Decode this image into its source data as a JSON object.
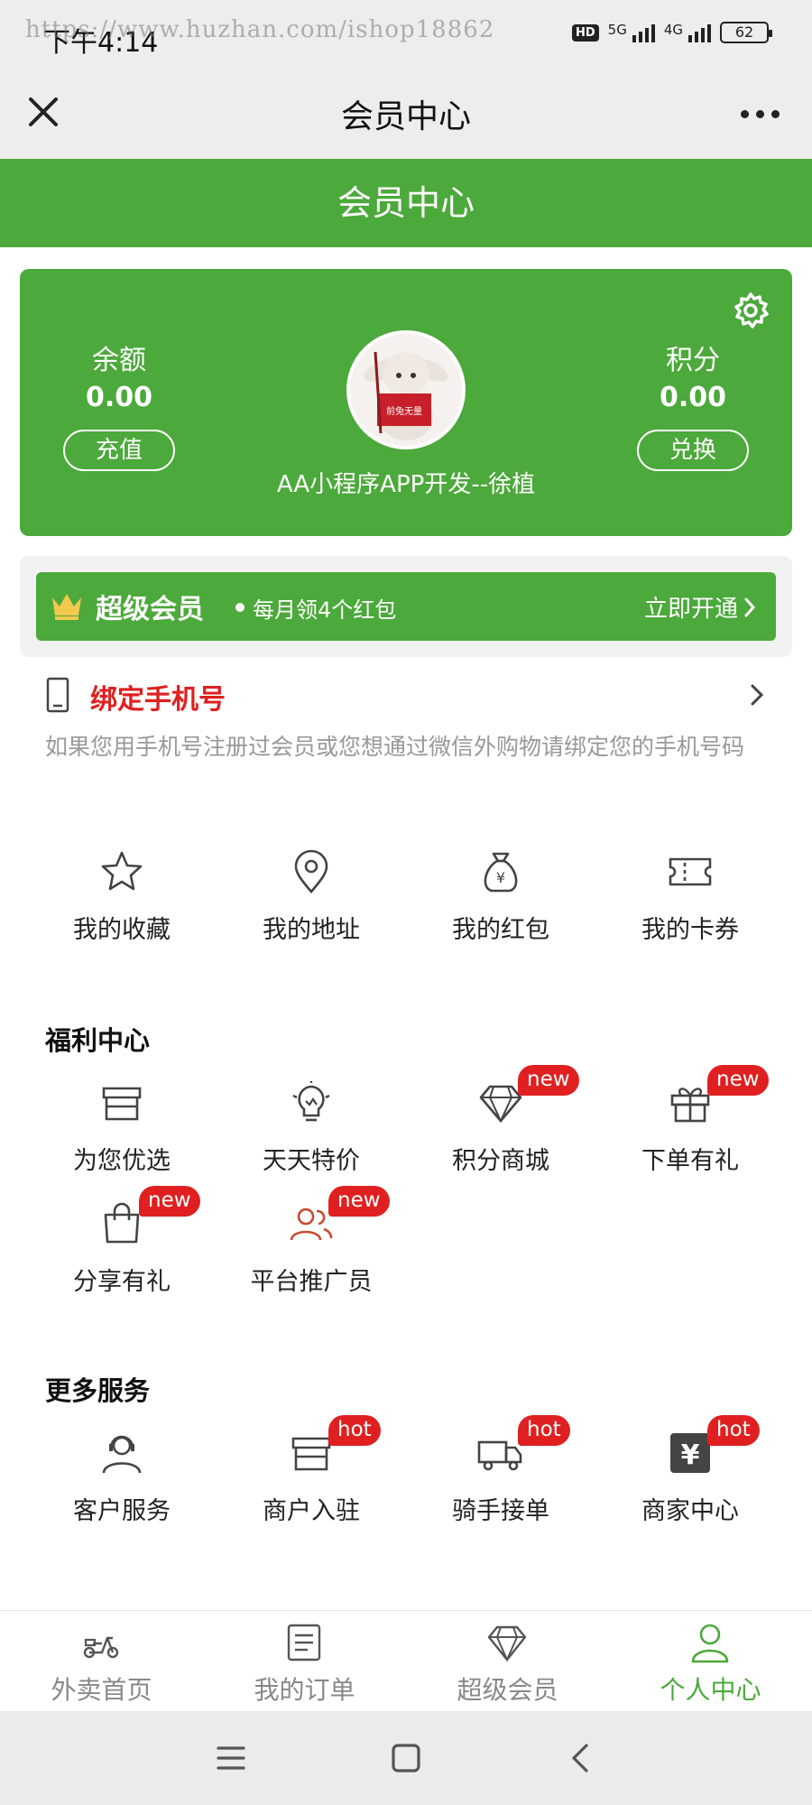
{
  "status_bar": {
    "time": "下午4:14",
    "watermark": "https://www.huzhan.com/ishop18862",
    "hd": "HD",
    "net1": "5G",
    "net2": "4G",
    "battery": "62"
  },
  "title_bar": {
    "title": "会员中心",
    "close_icon": "close-icon",
    "more_icon": "more-icon"
  },
  "header": {
    "title": "会员中心"
  },
  "member_card": {
    "balance_label": "余额",
    "balance_value": "0.00",
    "recharge_label": "充值",
    "points_label": "积分",
    "points_value": "0.00",
    "redeem_label": "兑换",
    "nickname": "AA小程序APP开发--徐植",
    "avatar_sign_text": "前兔无量"
  },
  "super_member": {
    "title": "超级会员",
    "subtitle": "每月领4个红包",
    "action": "立即开通"
  },
  "bind_phone": {
    "title": "绑定手机号",
    "description": "如果您用手机号注册过会员或您想通过微信外购物请绑定您的手机号码"
  },
  "quick_links": [
    {
      "label": "我的收藏",
      "icon": "star-icon"
    },
    {
      "label": "我的地址",
      "icon": "location-icon"
    },
    {
      "label": "我的红包",
      "icon": "money-bag-icon"
    },
    {
      "label": "我的卡券",
      "icon": "coupon-icon"
    }
  ],
  "welfare": {
    "title": "福利中心",
    "items": [
      {
        "label": "为您优选",
        "icon": "store-icon",
        "badge": ""
      },
      {
        "label": "天天特价",
        "icon": "lightbulb-icon",
        "badge": ""
      },
      {
        "label": "积分商城",
        "icon": "diamond-icon",
        "badge": "new"
      },
      {
        "label": "下单有礼",
        "icon": "gift-icon",
        "badge": "new"
      },
      {
        "label": "分享有礼",
        "icon": "shopping-bag-icon",
        "badge": "new"
      },
      {
        "label": "平台推广员",
        "icon": "promoter-icon",
        "badge": "new"
      }
    ]
  },
  "more_services": {
    "title": "更多服务",
    "items": [
      {
        "label": "客户服务",
        "icon": "customer-service-icon",
        "badge": ""
      },
      {
        "label": "商户入驻",
        "icon": "store-icon",
        "badge": "hot"
      },
      {
        "label": "骑手接单",
        "icon": "truck-icon",
        "badge": "hot"
      },
      {
        "label": "商家中心",
        "icon": "yen-icon",
        "badge": "hot"
      }
    ]
  },
  "tab_bar": {
    "tabs": [
      {
        "label": "外卖首页",
        "icon": "scooter-icon",
        "active": false
      },
      {
        "label": "我的订单",
        "icon": "order-list-icon",
        "active": false
      },
      {
        "label": "超级会员",
        "icon": "diamond-icon",
        "active": false
      },
      {
        "label": "个人中心",
        "icon": "person-icon",
        "active": true
      }
    ]
  },
  "colors": {
    "primary_green": "#4ca93b",
    "badge_red": "#e02020",
    "text_muted": "#999999",
    "title_bar_bg": "#ededed"
  }
}
